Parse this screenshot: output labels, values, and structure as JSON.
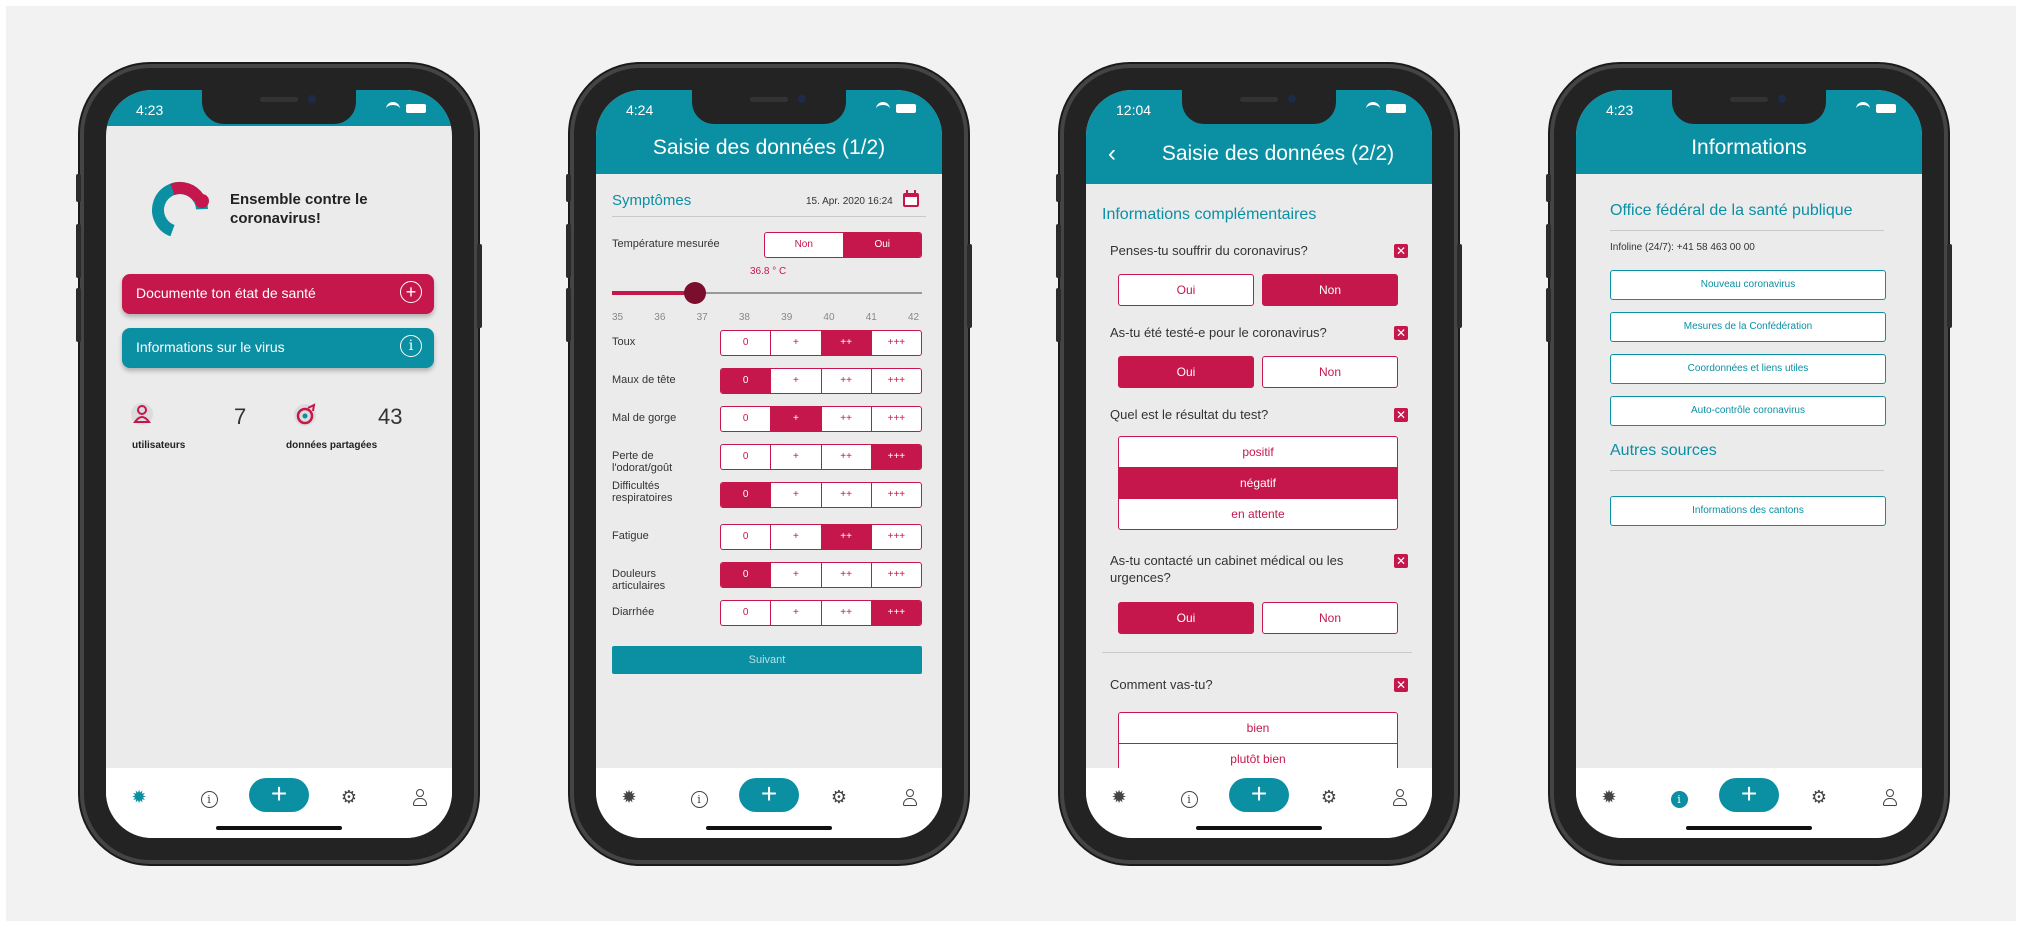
{
  "brand": {
    "primary": "#0b8fa3",
    "accent": "#c5174b",
    "background": "#f2f2f2"
  },
  "screen1": {
    "time": "4:23",
    "logo_text": "Ensemble contre le coronavirus!",
    "btn_document": "Documente ton état de santé",
    "btn_info": "Informations sur le virus",
    "stat_users_count": "7",
    "stat_users_label": "utilisateurs",
    "stat_data_count": "43",
    "stat_data_label": "données partagées"
  },
  "screen2": {
    "time": "4:24",
    "title": "Saisie des données (1/2)",
    "section": "Symptômes",
    "datetime": "15. Apr. 2020 16:24",
    "temp_label": "Température mesurée",
    "temp_no": "Non",
    "temp_yes": "Oui",
    "temp_value_text": "36.8 ° C",
    "temp_value": 36.8,
    "temp_ticks": [
      "35",
      "36",
      "37",
      "38",
      "39",
      "40",
      "41",
      "42"
    ],
    "levels": [
      "0",
      "+",
      "++",
      "+++"
    ],
    "symptoms": [
      {
        "label": "Toux",
        "selected": 2
      },
      {
        "label": "Maux de tête",
        "selected": 0
      },
      {
        "label": "Mal de gorge",
        "selected": 1
      },
      {
        "label": "Perte de l'odorat/goût",
        "selected": 3
      },
      {
        "label": "Difficultés respiratoires",
        "selected": 0
      },
      {
        "label": "Fatigue",
        "selected": 2
      },
      {
        "label": "Douleurs articulaires",
        "selected": 0
      },
      {
        "label": "Diarrhée",
        "selected": 3
      }
    ],
    "next": "Suivant"
  },
  "screen3": {
    "time": "12:04",
    "title": "Saisie des données (2/2)",
    "section": "Informations complémentaires",
    "q1": "Penses-tu souffrir du coronavirus?",
    "q2": "As-tu été testé-e pour le coronavirus?",
    "q3": "Quel est le résultat du test?",
    "q4": "As-tu contacté un cabinet médical ou les urgences?",
    "q5": "Comment vas-tu?",
    "yes": "Oui",
    "no": "Non",
    "result_pos": "positif",
    "result_neg": "négatif",
    "result_wait": "en attente",
    "feel_good": "bien",
    "feel_rather": "plutôt bien"
  },
  "screen4": {
    "time": "4:23",
    "title": "Informations",
    "section1": "Office fédéral de la santé publique",
    "infoline": "Infoline (24/7): +41 58 463 00 00",
    "links": [
      "Nouveau coronavirus",
      "Mesures de la Confédération",
      "Coordonnées et liens utiles",
      "Auto-contrôle coronavirus"
    ],
    "section2": "Autres sources",
    "link_cantons": "Informations des cantons"
  }
}
